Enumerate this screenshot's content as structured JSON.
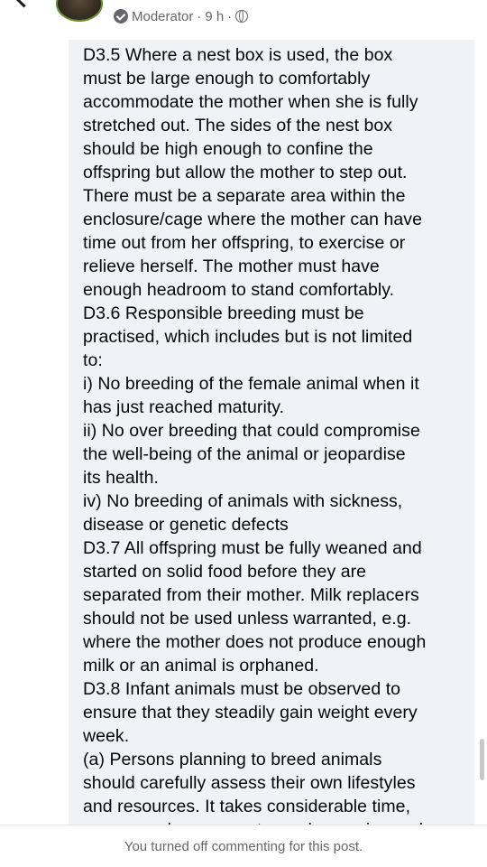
{
  "header": {
    "role": "Moderator",
    "separator1": "·",
    "time": "9 h",
    "separator2": "·"
  },
  "post": {
    "lines": [
      "D3.5 Where a nest box is used, the box",
      "must be large enough to comfortably",
      "accommodate the mother when she is fully",
      "stretched out. The sides of the nest box",
      "should be high enough to confine the",
      "offspring but allow the mother to step out.",
      "There must be a separate area within the",
      "enclosure/cage where the mother can have",
      "time out from her offspring, to exercise or",
      "relieve herself. The mother must have",
      "enough headroom to stand comfortably.",
      "D3.6 Responsible breeding must be",
      "practised, which includes but is not limited",
      "to:",
      "i) No breeding of the female animal when it",
      "has just reached maturity.",
      "ii) No over breeding that could compromise",
      "the well-being of the animal or jeopardise",
      "its health.",
      "iv) No breeding of animals with sickness,",
      "disease or genetic defects",
      "D3.7 All offspring must be fully weaned and",
      "started on solid food before they are",
      "separated from their mother. Milk replacers",
      "should not be used unless warranted, e.g.",
      "where the mother does not produce enough",
      "milk or an animal is orphaned.",
      "D3.8 Infant animals must be observed to",
      "ensure that they steadily gain weight every",
      "week.",
      " (a) Persons planning to breed animals",
      "should carefully assess their own lifestyles",
      "and resources. It takes considerable time,",
      "energy and expenses to produce, raise and"
    ]
  },
  "footer": {
    "notice": "You turned off commenting for this post."
  }
}
